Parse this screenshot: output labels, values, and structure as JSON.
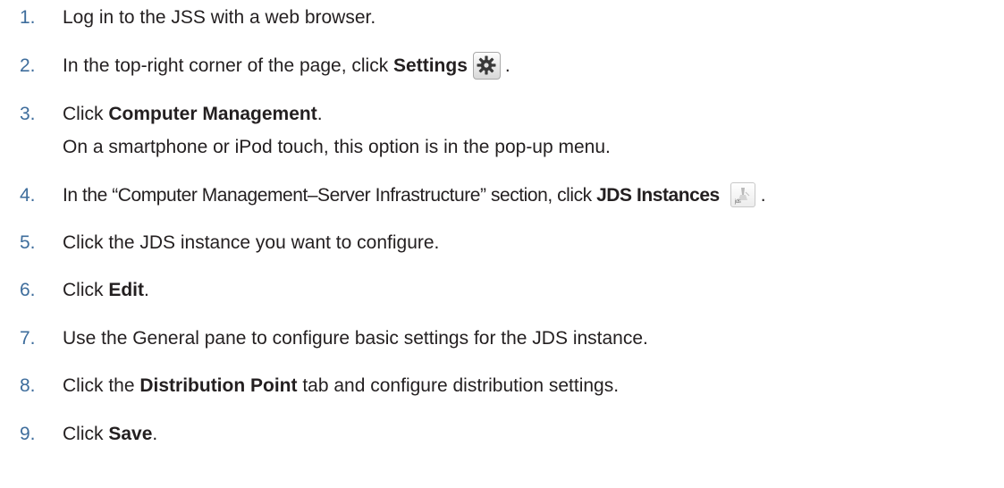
{
  "steps": [
    {
      "num": "1.",
      "text": "Log in to the JSS with a web browser."
    },
    {
      "num": "2.",
      "pre": "In the top-right corner of the page, click ",
      "bold": "Settings",
      "post": "."
    },
    {
      "num": "3.",
      "pre": "Click ",
      "bold": "Computer Management",
      "post": ".",
      "note": "On a smartphone or iPod touch, this option is in the pop-up menu."
    },
    {
      "num": "4.",
      "pre": "In the “Computer Management–Server Infrastructure” section, click ",
      "bold": "JDS Instances",
      "post": "."
    },
    {
      "num": "5.",
      "text": "Click the JDS instance you want to configure."
    },
    {
      "num": "6.",
      "pre": "Click ",
      "bold": "Edit",
      "post": "."
    },
    {
      "num": "7.",
      "text": "Use the General pane to configure basic settings for the JDS instance."
    },
    {
      "num": "8.",
      "pre": "Click the ",
      "bold": "Distribution Point",
      "post": " tab and configure distribution settings."
    },
    {
      "num": "9.",
      "pre": "Click ",
      "bold": "Save",
      "post": "."
    }
  ],
  "icons": {
    "settings": "gear-icon",
    "jds_instances": "jds-icon",
    "jds_icon_label": "jds"
  },
  "colors": {
    "step_number": "#3e6d9c",
    "text": "#231f20"
  }
}
